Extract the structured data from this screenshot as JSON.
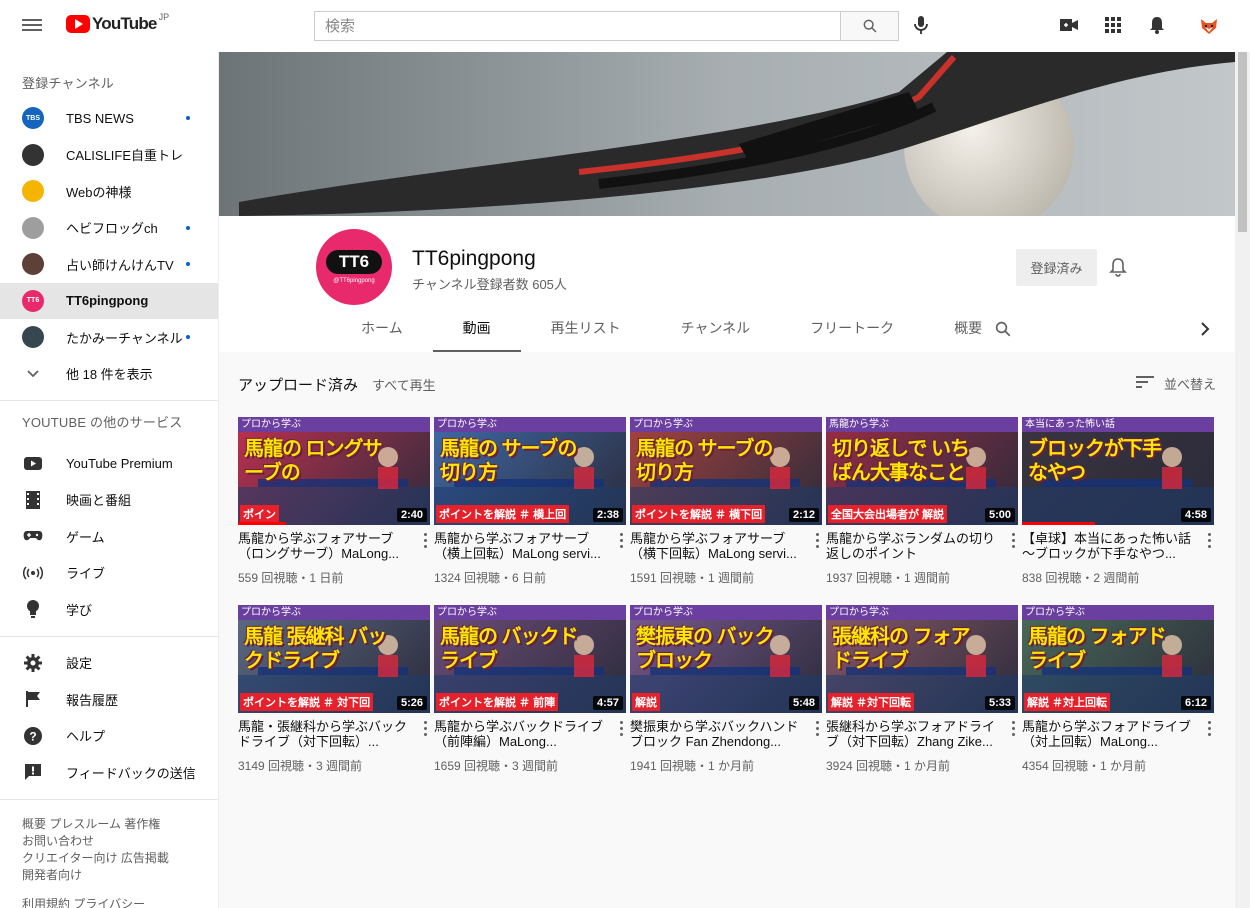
{
  "masthead": {
    "logo_text": "YouTube",
    "region": "JP",
    "search_placeholder": "検索"
  },
  "sidebar": {
    "subscriptions_title": "登録チャンネル",
    "channels": [
      {
        "label": "TBS NEWS",
        "badge": "TBS",
        "color": "#1565c0",
        "new": true
      },
      {
        "label": "CALISLIFE自重トレ",
        "badge": "",
        "color": "#333333",
        "new": false
      },
      {
        "label": "Webの神様",
        "badge": "",
        "color": "#f4b400",
        "new": false
      },
      {
        "label": "ヘビフロッグch",
        "badge": "",
        "color": "#9e9e9e",
        "new": true
      },
      {
        "label": "占い師けんけんTV",
        "badge": "",
        "color": "#5d4037",
        "new": true
      },
      {
        "label": "TT6pingpong",
        "badge": "TT6",
        "color": "#e8296b",
        "new": false
      },
      {
        "label": "たかみーチャンネル",
        "badge": "",
        "color": "#37474f",
        "new": true
      }
    ],
    "show_more": "他 18 件を表示",
    "more_services_title": "YOUTUBE の他のサービス",
    "services": [
      {
        "label": "YouTube Premium"
      },
      {
        "label": "映画と番組"
      },
      {
        "label": "ゲーム"
      },
      {
        "label": "ライブ"
      },
      {
        "label": "学び"
      }
    ],
    "settings": [
      {
        "label": "設定"
      },
      {
        "label": "報告履歴"
      },
      {
        "label": "ヘルプ"
      },
      {
        "label": "フィードバックの送信"
      }
    ],
    "footer": {
      "line1": "概要  プレスルーム  著作権",
      "line2": "お問い合わせ",
      "line3": "クリエイター向け  広告掲載",
      "line4": "開発者向け",
      "line5": "利用規約  プライバシー"
    }
  },
  "channel": {
    "name": "TT6pingpong",
    "subscribers": "チャンネル登録者数 605人",
    "avatar_text": "TT6",
    "avatar_sub": "@TT6pingpong",
    "subscribe_label": "登録済み",
    "tabs": [
      "ホーム",
      "動画",
      "再生リスト",
      "チャンネル",
      "フリートーク",
      "概要"
    ],
    "active_tab": "動画"
  },
  "content": {
    "section_title": "アップロード済み",
    "play_all": "すべて再生",
    "sort_label": "並べ替え",
    "videos": [
      {
        "title": "馬龍から学ぶフォアサーブ（ロングサーブ）MaLong...",
        "stats": "559 回視聴・1 日前",
        "duration": "2:40",
        "band": "プロから学ぶ",
        "big": "馬龍の ロングサーブの",
        "caption": "ポイン",
        "progress": 0.25,
        "bg": "#c03050"
      },
      {
        "title": "馬龍から学ぶフォアサーブ（横上回転）MaLong servi...",
        "stats": "1324 回視聴・6 日前",
        "duration": "2:38",
        "band": "プロから学ぶ",
        "big": "馬龍の サーブの切り方",
        "caption": "ポイントを解説  ＃ 横上回",
        "progress": 0,
        "bg": "#3f6aa8"
      },
      {
        "title": "馬龍から学ぶフォアサーブ（横下回転）MaLong servi...",
        "stats": "1591 回視聴・1 週間前",
        "duration": "2:12",
        "band": "プロから学ぶ",
        "big": "馬龍の サーブの切り方",
        "caption": "ポイントを解説  ＃ 横下回",
        "progress": 0,
        "bg": "#a8423f"
      },
      {
        "title": "馬龍から学ぶランダムの切り返しのポイント",
        "stats": "1937 回視聴・1 週間前",
        "duration": "5:00",
        "band": "馬龍から学ぶ",
        "big": "切り返しで いちばん大事なこと",
        "caption": "全国大会出場者が  解説",
        "progress": 0,
        "bg": "#9b2c46"
      },
      {
        "title": "【卓球】本当にあった怖い話～ブロックが下手なやつ...",
        "stats": "838 回視聴・2 週間前",
        "duration": "4:58",
        "band": "本当にあった怖い話",
        "big": "ブロックが下手なやつ",
        "caption": "",
        "progress": 0.38,
        "bg": "#3a3440"
      },
      {
        "title": "馬龍・張継科から学ぶバックドライブ（対下回転）...",
        "stats": "3149 回視聴・3 週間前",
        "duration": "5:26",
        "band": "プロから学ぶ",
        "big": "馬龍 張継科 バックドライブ",
        "caption": "ポイントを解説  ＃ 対下回",
        "progress": 0,
        "bg": "#5d6b86"
      },
      {
        "title": "馬龍から学ぶバックドライブ（前陣編）MaLong...",
        "stats": "1659 回視聴・3 週間前",
        "duration": "4:57",
        "band": "プロから学ぶ",
        "big": "馬龍の バックドライブ",
        "caption": "ポイントを解説  ＃ 前陣",
        "progress": 0,
        "bg": "#6e4d7a"
      },
      {
        "title": "樊振東から学ぶバックハンドブロック Fan Zhendong...",
        "stats": "1941 回視聴・1 か月前",
        "duration": "5:48",
        "band": "プロから学ぶ",
        "big": "樊振東の バックブロック",
        "caption": "解説",
        "progress": 0,
        "bg": "#7a5a8f"
      },
      {
        "title": "張継科から学ぶフォアドライブ（対下回転）Zhang Zike...",
        "stats": "3924 回視聴・1 か月前",
        "duration": "5:33",
        "band": "プロから学ぶ",
        "big": "張継科の フォアドライブ",
        "caption": "解説   ＃対下回転",
        "progress": 0,
        "bg": "#8a5a6a"
      },
      {
        "title": "馬龍から学ぶフォアドライブ（対上回転）MaLong...",
        "stats": "4354 回視聴・1 か月前",
        "duration": "6:12",
        "band": "プロから学ぶ",
        "big": "馬龍の フォアドライブ",
        "caption": "解説   ＃対上回転",
        "progress": 0,
        "bg": "#4a6c5a"
      }
    ]
  },
  "colors": {
    "accent_red": "#ff0000",
    "thumb_band": "#6b3fa0",
    "thumb_text": "#ffe600",
    "caption_red": "#e5212b"
  }
}
